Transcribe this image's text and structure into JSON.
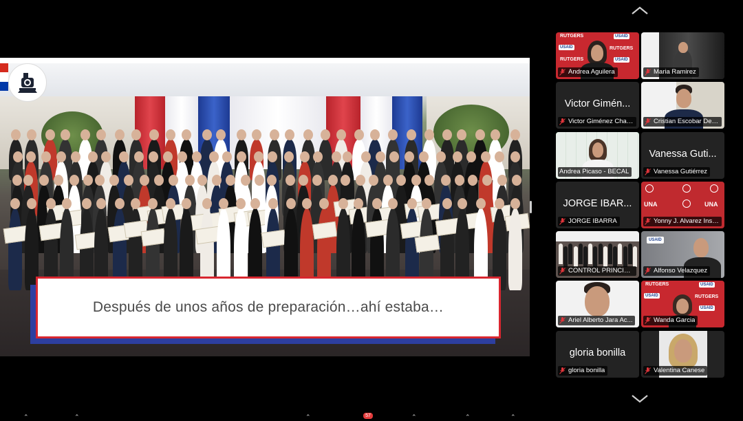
{
  "slide": {
    "caption": "Después de unos años de preparación…ahí estaba…",
    "flag_colors": [
      "#d52b1e",
      "#ffffff",
      "#0038a8"
    ]
  },
  "gallery": {
    "nav_up_icon": "chevron-up-icon",
    "nav_down_icon": "chevron-down-icon",
    "participants": [
      {
        "label": "Andrea Aguilera",
        "video": true
      },
      {
        "label": "Maria Ramirez",
        "video": true
      },
      {
        "label": "Victor Giménez Chavez",
        "display_name": "Victor Gimén...",
        "video": false
      },
      {
        "label": "Cristian Escobar Dec...",
        "video": true
      },
      {
        "label": "Andrea Picaso - BECAL",
        "video": true,
        "active_speaker": true
      },
      {
        "label": "Vanessa Gutiérrez",
        "display_name": "Vanessa Guti...",
        "video": false
      },
      {
        "label": "JORGE IBARRA",
        "display_name": "JORGE IBAR...",
        "video": false
      },
      {
        "label": "Yonny J. Alvarez Insfr...",
        "video": true
      },
      {
        "label": "CONTROL PRINCIPAL",
        "video": true
      },
      {
        "label": "Alfonso Velazquez",
        "video": true
      },
      {
        "label": "Ariel Alberto Jara Ac...",
        "video": true
      },
      {
        "label": "Wanda Garcia",
        "video": true
      },
      {
        "label": "gloria bonilla",
        "display_name": "gloria bonilla",
        "video": false
      },
      {
        "label": "Valentina Canese",
        "video": true
      }
    ]
  },
  "toolbar": {
    "chat_badge": "57"
  },
  "colors": {
    "active_speaker": "#2ec15d",
    "muted_icon": "#e0353b",
    "caption_border": "#d8262f",
    "caption_shadow": "#2d3fa0"
  }
}
